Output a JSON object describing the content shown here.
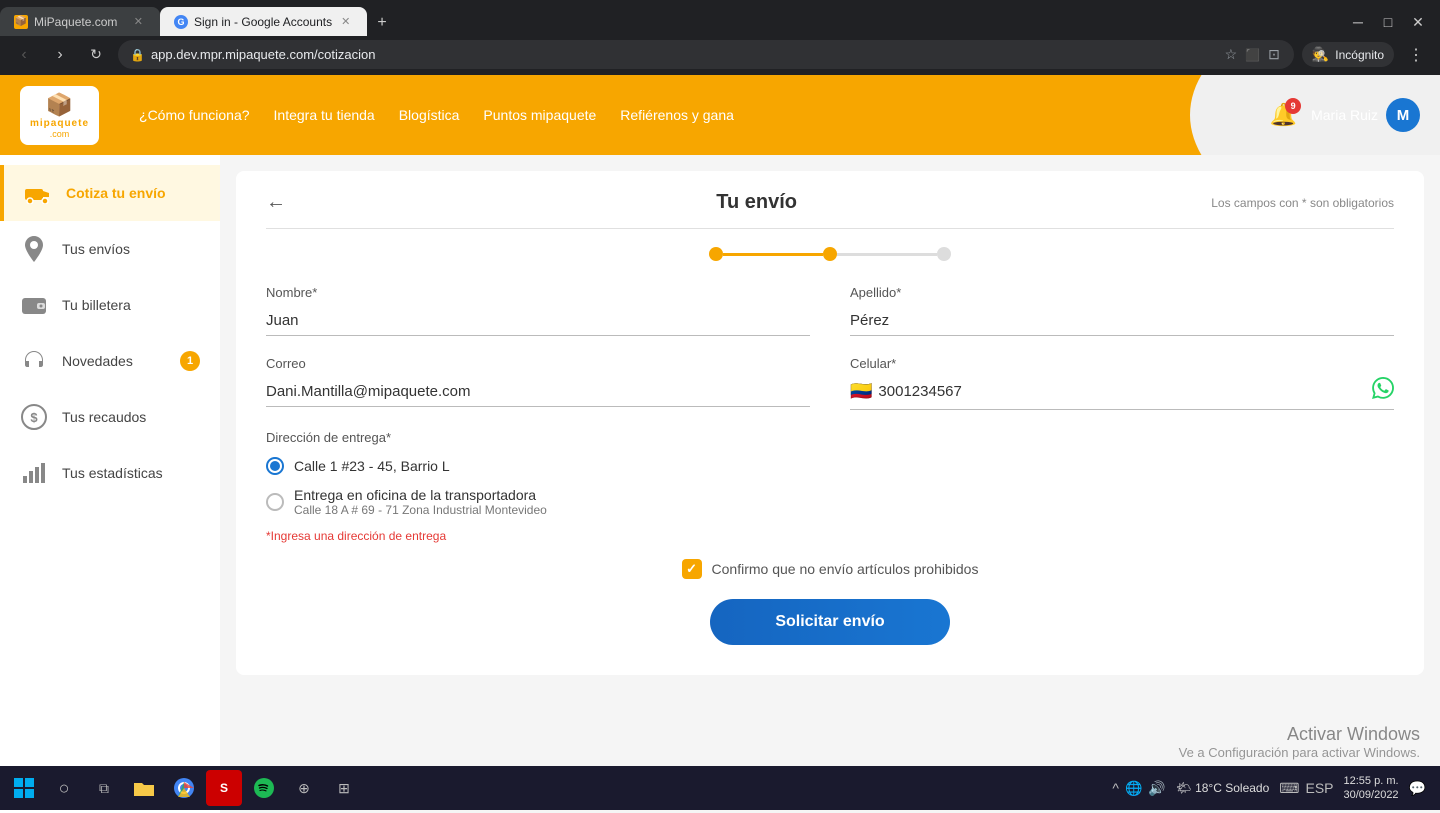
{
  "browser": {
    "tabs": [
      {
        "id": "tab1",
        "label": "MiPaquete.com",
        "favicon": "📦",
        "active": false,
        "url": ""
      },
      {
        "id": "tab2",
        "label": "Sign in - Google Accounts",
        "favicon": "G",
        "active": true,
        "url": ""
      }
    ],
    "address": "app.dev.mpr.mipaquete.com/cotizacion",
    "incognito_label": "Incógnito"
  },
  "topnav": {
    "logo_text": "mipaquete",
    "logo_com": ".com",
    "links": [
      "¿Cómo funciona?",
      "Integra tu tienda",
      "Blogística",
      "Puntos mipaquete",
      "Refiérenos y gana"
    ],
    "notification_count": "9",
    "user_name": "Maria Ruiz",
    "user_initial": "M"
  },
  "sidebar": {
    "items": [
      {
        "id": "cotiza",
        "label": "Cotiza tu envío",
        "active": true
      },
      {
        "id": "envios",
        "label": "Tus envíos",
        "active": false
      },
      {
        "id": "billetera",
        "label": "Tu billetera",
        "active": false
      },
      {
        "id": "novedades",
        "label": "Novedades",
        "active": false,
        "badge": "1"
      },
      {
        "id": "recaudos",
        "label": "Tus recaudos",
        "active": false
      },
      {
        "id": "estadisticas",
        "label": "Tus estadísticas",
        "active": false
      }
    ]
  },
  "form": {
    "title": "Tu envío",
    "required_note": "Los campos con * son obligatorios",
    "back_icon": "←",
    "fields": {
      "nombre_label": "Nombre*",
      "nombre_value": "Juan",
      "apellido_label": "Apellido*",
      "apellido_value": "Pérez",
      "correo_label": "Correo",
      "correo_value": "Dani.Mantilla@mipaquete.com",
      "celular_label": "Celular*",
      "celular_value": "3001234567",
      "direccion_label": "Dirección de entrega*"
    },
    "radio_options": [
      {
        "id": "r1",
        "selected": true,
        "text": "Calle 1 #23 - 45, Barrio L"
      },
      {
        "id": "r2",
        "selected": false,
        "text": "Entrega en oficina de la transportadora",
        "subtext": "Calle 18 A # 69 - 71 Zona Industrial Montevideo"
      }
    ],
    "error_text": "*Ingresa una dirección de entrega",
    "checkbox_label": "Confirmo que no envío artículos prohibidos",
    "submit_label": "Solicitar envío"
  },
  "activate_windows": {
    "title": "Activar Windows",
    "subtitle": "Ve a Configuración para activar Windows."
  },
  "taskbar": {
    "time": "12:55 p. m.",
    "date": "30/09/2022",
    "weather": "18°C  Soleado",
    "lang": "ESP"
  }
}
